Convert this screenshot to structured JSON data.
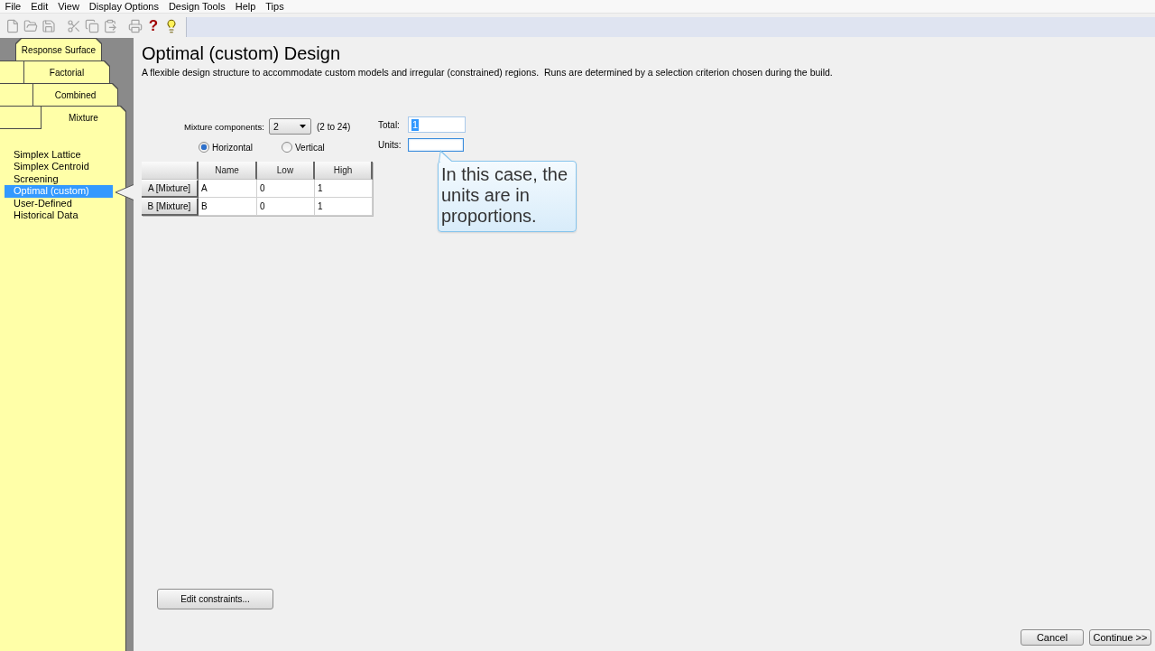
{
  "menu_bar": [
    "File",
    "Edit",
    "View",
    "Display Options",
    "Design Tools",
    "Help",
    "Tips"
  ],
  "toolbar": [
    [
      {
        "kind": "new",
        "disabled": true
      },
      {
        "kind": "open",
        "disabled": true
      },
      {
        "kind": "save",
        "disabled": true
      }
    ],
    [
      {
        "kind": "cut",
        "disabled": true
      },
      {
        "kind": "copy",
        "disabled": true
      },
      {
        "kind": "paste",
        "disabled": true
      }
    ],
    [
      {
        "kind": "print",
        "disabled": true
      },
      {
        "kind": "help",
        "disabled": false,
        "glyph": "?"
      },
      {
        "kind": "tip",
        "disabled": false
      }
    ]
  ],
  "sidebar": {
    "tabs": [
      {
        "label": "Response Surface",
        "selected": false
      },
      {
        "label": "Factorial",
        "selected": false
      },
      {
        "label": "Combined",
        "selected": false
      },
      {
        "label": "Mixture",
        "selected": true
      }
    ],
    "items": [
      {
        "label": "Simplex Lattice",
        "selected": false
      },
      {
        "label": "Simplex Centroid",
        "selected": false
      },
      {
        "label": "Screening",
        "selected": false
      },
      {
        "label": "Optimal (custom)",
        "selected": true
      },
      {
        "label": "User-Defined",
        "selected": false
      },
      {
        "label": "Historical Data",
        "selected": false
      }
    ]
  },
  "main": {
    "title": "Optimal (custom) Design",
    "description": "A flexible design structure to accommodate custom models and irregular (constrained) regions.  Runs are determined by a selection criterion chosen during the build.",
    "mixture_components": {
      "label": "Mixture components:",
      "value": "2",
      "range": "(2 to 24)"
    },
    "layout_options": [
      {
        "label": "Horizontal",
        "selected": true
      },
      {
        "label": "Vertical",
        "selected": false
      }
    ],
    "total": {
      "label": "Total:",
      "value": "1",
      "value_selected": true,
      "focused": false
    },
    "units": {
      "label": "Units:",
      "focused": true
    },
    "tooltip": "In this case, the units are in proportions.",
    "table": {
      "columns": [
        "Name",
        "Low",
        "High"
      ],
      "rows": [
        {
          "header": "A [Mixture]",
          "cells": [
            "A",
            "0",
            "1"
          ]
        },
        {
          "header": "B [Mixture]",
          "cells": [
            "B",
            "0",
            "1"
          ]
        }
      ]
    },
    "edit_constraints": "Edit constraints...",
    "buttons": [
      "Cancel",
      "Continue >>"
    ]
  }
}
